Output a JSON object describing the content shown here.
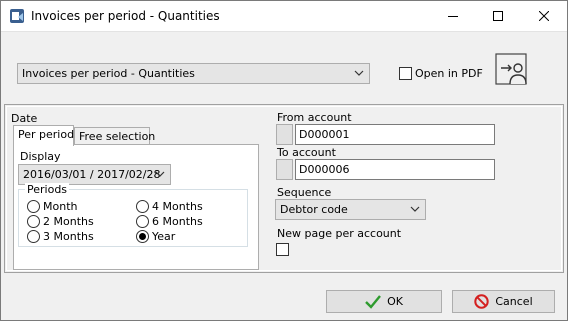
{
  "window": {
    "title": "Invoices per period - Quantities"
  },
  "report": {
    "selected": "Invoices per period - Quantities",
    "open_in_pdf_label": "Open in PDF",
    "open_in_pdf_checked": false
  },
  "date": {
    "section_label": "Date",
    "tabs": [
      {
        "label": "Per period",
        "active": true
      },
      {
        "label": "Free selection",
        "active": false
      }
    ],
    "display_label": "Display",
    "display_value": "2016/03/01 / 2017/02/28",
    "periods_label": "Periods",
    "periods": [
      {
        "label": "Month",
        "selected": false
      },
      {
        "label": "2 Months",
        "selected": false
      },
      {
        "label": "3 Months",
        "selected": false
      },
      {
        "label": "4 Months",
        "selected": false
      },
      {
        "label": "6 Months",
        "selected": false
      },
      {
        "label": "Year",
        "selected": true
      }
    ]
  },
  "accounts": {
    "from_label": "From account",
    "from_value": "D000001",
    "to_label": "To account",
    "to_value": "D000006"
  },
  "sequence": {
    "label": "Sequence",
    "value": "Debtor code"
  },
  "new_page": {
    "label": "New page per account",
    "checked": false
  },
  "buttons": {
    "ok_label": "OK",
    "cancel_label": "Cancel"
  },
  "colors": {
    "ok_check": "#2e9b2e",
    "cancel_icon": "#d42020",
    "title_bar": "#ffffff",
    "window_bg": "#f0f0f0"
  },
  "icons": {
    "app": "report-app-icon",
    "pdf": "export-to-person-icon",
    "ok": "check-icon",
    "cancel": "no-entry-icon"
  }
}
